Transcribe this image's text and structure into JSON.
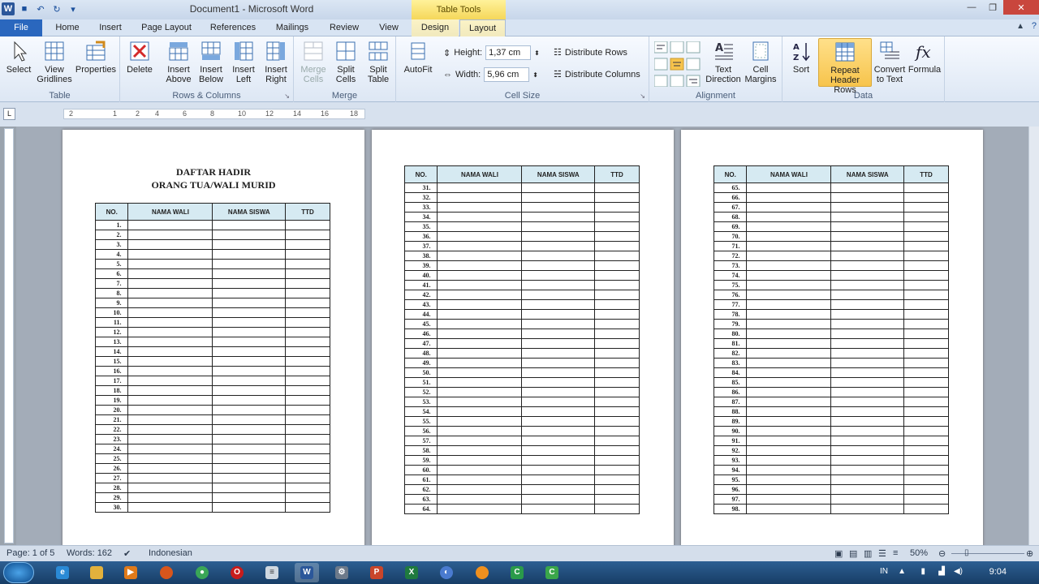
{
  "window": {
    "title": "Document1  -  Microsoft Word",
    "context_tab_group": "Table Tools"
  },
  "tabs": [
    "File",
    "Home",
    "Insert",
    "Page Layout",
    "References",
    "Mailings",
    "Review",
    "View",
    "Design",
    "Layout"
  ],
  "active_tab": "Layout",
  "ribbon": {
    "table": {
      "label": "Table",
      "buttons": [
        "Select",
        "View Gridlines",
        "Properties"
      ]
    },
    "rows_columns": {
      "label": "Rows & Columns",
      "buttons": [
        "Delete",
        "Insert Above",
        "Insert Below",
        "Insert Left",
        "Insert Right"
      ]
    },
    "merge": {
      "label": "Merge",
      "buttons": [
        "Merge Cells",
        "Split Cells",
        "Split Table"
      ]
    },
    "cell_size": {
      "label": "Cell Size",
      "autofit": "AutoFit",
      "height_label": "Height:",
      "height_value": "1,37 cm",
      "width_label": "Width:",
      "width_value": "5,96 cm",
      "distribute_rows": "Distribute Rows",
      "distribute_columns": "Distribute Columns"
    },
    "alignment": {
      "label": "Alignment",
      "buttons": [
        "Text Direction",
        "Cell Margins"
      ]
    },
    "data": {
      "label": "Data",
      "buttons": [
        "Sort",
        "Repeat Header Rows",
        "Convert to Text",
        "Formula"
      ]
    }
  },
  "ruler_marks": [
    "2",
    "1",
    "2",
    "4",
    "6",
    "8",
    "10",
    "12",
    "14",
    "16",
    "18"
  ],
  "document": {
    "heading_line1": "DAFTAR HADIR",
    "heading_line2": "ORANG TUA/WALI MURID",
    "columns": [
      "NO.",
      "NAMA WALI",
      "NAMA SISWA",
      "TTD"
    ],
    "page1_range": [
      1,
      30
    ],
    "page2_range": [
      31,
      64
    ],
    "page3_range": [
      65,
      98
    ]
  },
  "status": {
    "page": "Page: 1 of 5",
    "words": "Words: 162",
    "language": "Indonesian",
    "zoom": "50%"
  },
  "taskbar": {
    "time": "9:04",
    "lang": "IN"
  }
}
